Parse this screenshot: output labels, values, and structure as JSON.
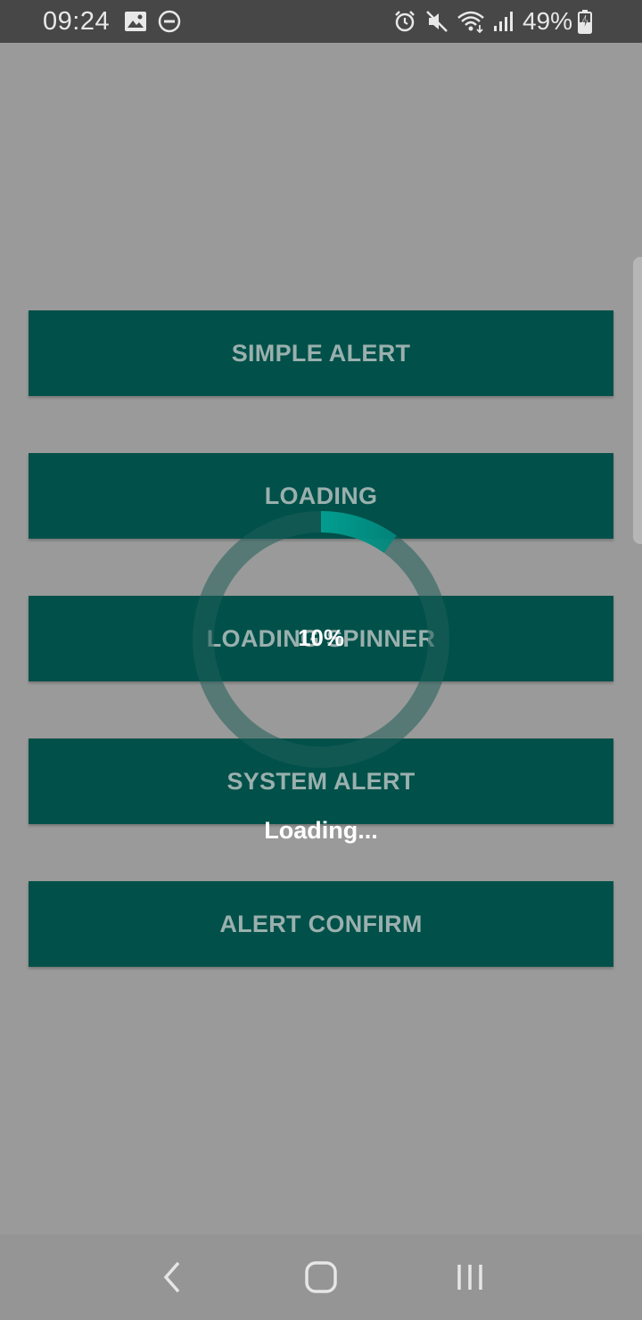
{
  "status_bar": {
    "time": "09:24",
    "battery_percent": "49%",
    "icons_left": [
      "image-icon",
      "do-not-disturb-icon"
    ],
    "icons_right": [
      "alarm-icon",
      "mute-icon",
      "wifi-icon",
      "signal-icon",
      "battery-charging-icon"
    ]
  },
  "buttons": [
    {
      "label": "SIMPLE ALERT"
    },
    {
      "label": "LOADING"
    },
    {
      "label": "LOADING SPINNER"
    },
    {
      "label": "SYSTEM ALERT"
    },
    {
      "label": "ALERT CONFIRM"
    }
  ],
  "loading_dialog": {
    "progress": 0.1,
    "progress_label": "10%",
    "message": "Loading...",
    "accent_color": "#00d4c0"
  },
  "nav_bar": {
    "icons": [
      "back-icon",
      "home-icon",
      "recents-icon"
    ]
  },
  "colors": {
    "button_bg": "#01504a",
    "button_text": "#9ab0ad",
    "overlay_bg": "#9a9a9a"
  }
}
